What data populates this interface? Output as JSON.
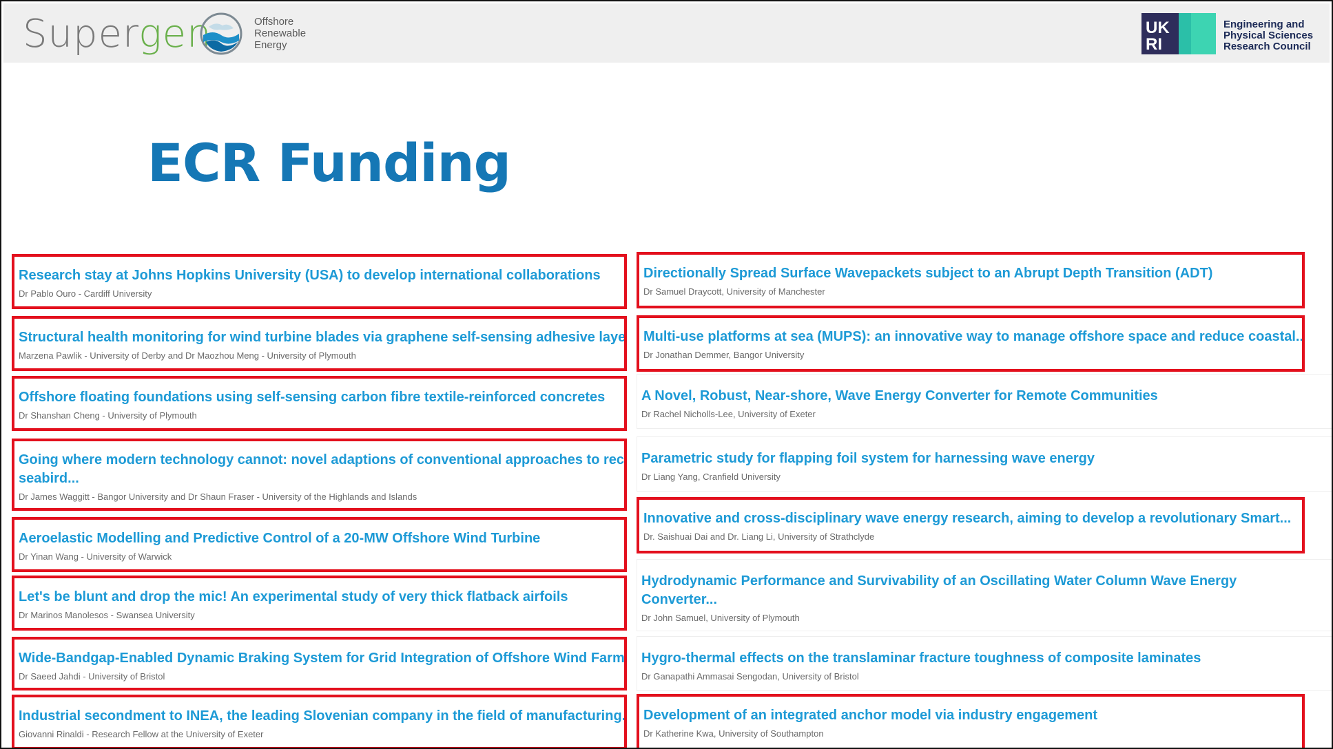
{
  "header": {
    "logo_main": "Supergen",
    "logo_sub_1": "Offshore",
    "logo_sub_2": "Renewable",
    "logo_sub_3": "Energy",
    "ukri_icon": "ukri-logo",
    "partner_line_1": "Engineering and",
    "partner_line_2": "Physical Sciences",
    "partner_line_3": "Research Council"
  },
  "page_title": "ECR Funding",
  "colors": {
    "title": "#1577b5",
    "link": "#1d9ad6",
    "highlight": "#e3101d"
  },
  "left_column": [
    {
      "title": "Research stay at Johns Hopkins University (USA) to develop international collaborations",
      "authors": "Dr Pablo Ouro - Cardiff University",
      "highlighted": true
    },
    {
      "title": "Structural health monitoring for wind turbine blades via graphene self-sensing adhesive layer...",
      "authors": "Marzena Pawlik - University of Derby and Dr Maozhou Meng - University of Plymouth",
      "highlighted": true
    },
    {
      "title": "Offshore floating foundations using self-sensing carbon fibre textile-reinforced concretes",
      "authors": "Dr Shanshan Cheng - University of Plymouth",
      "highlighted": true
    },
    {
      "title": "Going where modern technology cannot: novel adaptions of conventional approaches to recor",
      "title_2": "seabird...",
      "authors": "Dr James Waggitt - Bangor University and Dr Shaun Fraser - University of the Highlands and Islands",
      "highlighted": true
    },
    {
      "title": "Aeroelastic Modelling and Predictive Control of a 20-MW Offshore Wind Turbine",
      "authors": "Dr Yinan Wang - University of Warwick",
      "highlighted": true
    },
    {
      "title": "Let's be blunt and drop the mic! An experimental study of very thick flatback airfoils",
      "authors": "Dr Marinos Manolesos - Swansea University",
      "highlighted": true
    },
    {
      "title": "Wide-Bandgap-Enabled Dynamic Braking System for Grid Integration of Offshore Wind Farms",
      "authors": "Dr Saeed Jahdi - University of Bristol",
      "highlighted": true
    },
    {
      "title": "Industrial secondment to INEA, the leading Slovenian company in the field of manufacturing...",
      "authors": "Giovanni Rinaldi - Research Fellow at the University of Exeter",
      "highlighted": true
    }
  ],
  "right_column": [
    {
      "title": "Directionally Spread Surface Wavepackets subject to an Abrupt Depth Transition (ADT)",
      "authors": "Dr Samuel Draycott, University of Manchester",
      "highlighted": true
    },
    {
      "title": "Multi-use platforms at sea (MUPS): an innovative way to manage offshore space and reduce coastal...",
      "authors": "Dr Jonathan Demmer, Bangor University",
      "highlighted": true
    },
    {
      "title": "A Novel, Robust, Near-shore, Wave Energy Converter for Remote Communities",
      "authors": "Dr Rachel Nicholls-Lee, University of Exeter",
      "highlighted": false
    },
    {
      "title": "Parametric study for flapping foil system for harnessing wave energy",
      "authors": "Dr Liang Yang, Cranfield University",
      "highlighted": false
    },
    {
      "title": "Innovative and cross-disciplinary wave energy research, aiming to develop a revolutionary Smart...",
      "authors": "Dr. Saishuai Dai and Dr. Liang Li, University of Strathclyde",
      "highlighted": true
    },
    {
      "title": "Hydrodynamic Performance and Survivability of an Oscillating Water Column Wave Energy",
      "title_2": "Converter...",
      "authors": "Dr John Samuel, University of Plymouth",
      "highlighted": false
    },
    {
      "title": "Hygro-thermal effects on the translaminar fracture toughness of composite laminates",
      "authors": "Dr Ganapathi Ammasai Sengodan, University of Bristol",
      "highlighted": false
    },
    {
      "title": "Development of an integrated anchor model via industry engagement",
      "authors": "Dr Katherine Kwa, University of Southampton",
      "highlighted": true
    }
  ]
}
